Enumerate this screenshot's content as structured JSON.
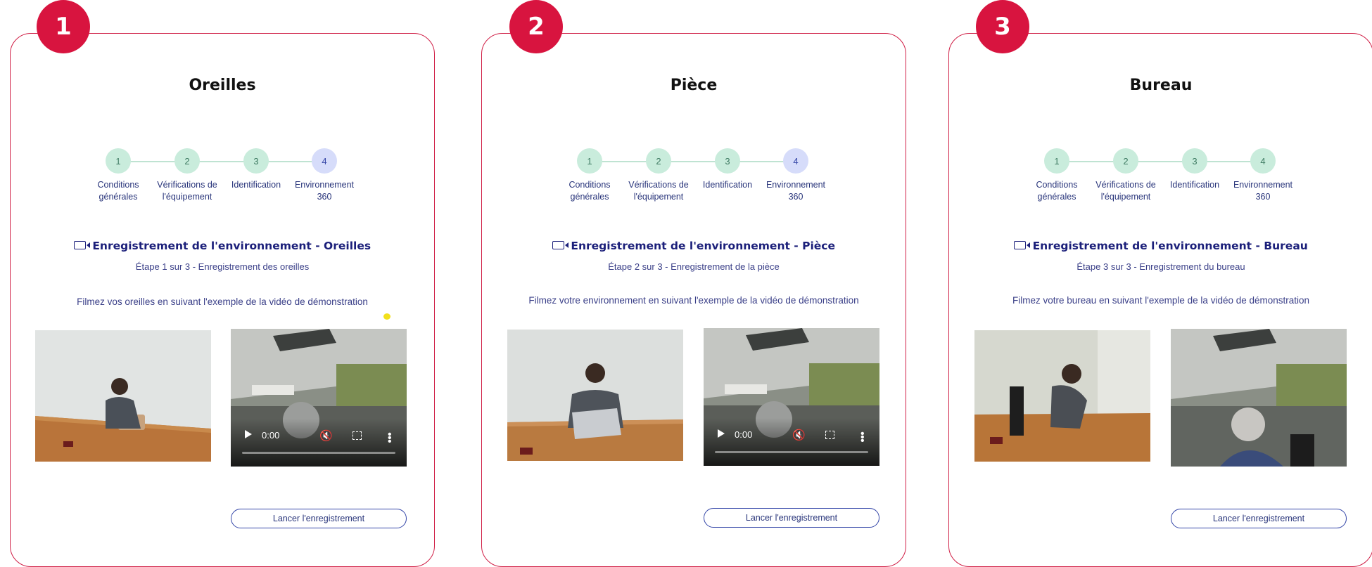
{
  "steps": [
    "1",
    "2",
    "3",
    "4"
  ],
  "step_labels": [
    [
      "Conditions",
      "générales"
    ],
    [
      "Vérifications de",
      "l'équipement"
    ],
    [
      "Identification",
      ""
    ],
    [
      "Environnement",
      "360"
    ]
  ],
  "step_labels_card2": [
    [
      "Conditions",
      "générales"
    ],
    [
      "Vérifications de",
      "l'équipement"
    ],
    [
      "Identification",
      ""
    ],
    [
      "Environnement",
      "360"
    ]
  ],
  "video": {
    "time": "0:00"
  },
  "record_button": "Lancer l'enregistrement",
  "colors": {
    "accent": "#d8143f",
    "navy": "#1b1f7a",
    "done_step": "#c9ecdc",
    "active_step": "#d6dcfa"
  },
  "cards": [
    {
      "number": "1",
      "title": "Oreilles",
      "heading": "Enregistrement de l'environnement - Oreilles",
      "substep": "Étape 1 sur 3 - Enregistrement des oreilles",
      "instruction": "Filmez vos oreilles en suivant l'exemple de la vidéo de démonstration"
    },
    {
      "number": "2",
      "title": "Pièce",
      "heading": "Enregistrement de l'environnement - Pièce",
      "substep": "Étape 2 sur 3 - Enregistrement de la pièce",
      "instruction": "Filmez votre environnement en suivant l'exemple de la vidéo de démonstration"
    },
    {
      "number": "3",
      "title": "Bureau",
      "heading": "Enregistrement de l'environnement - Bureau",
      "substep": "Étape 3 sur 3 - Enregistrement du bureau",
      "instruction": "Filmez votre bureau en suivant l'exemple de la vidéo de démonstration"
    }
  ]
}
